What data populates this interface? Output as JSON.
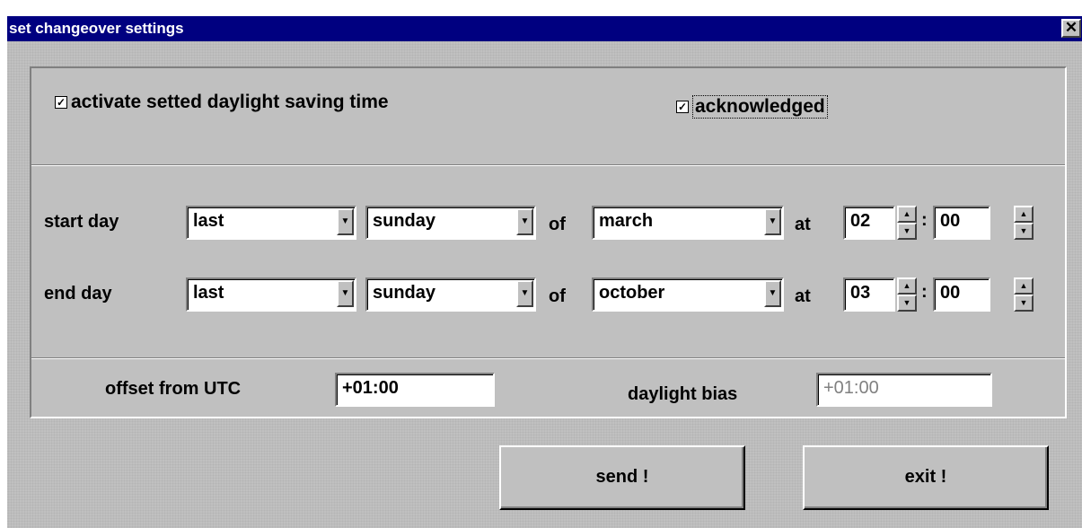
{
  "window": {
    "title": "set changeover settings",
    "close_symbol": "✕"
  },
  "top": {
    "activate_label": "activate setted daylight saving time",
    "activate_checked": true,
    "ack_label": "acknowledged",
    "ack_checked": true
  },
  "start": {
    "label": "start day",
    "week": "last",
    "weekday": "sunday",
    "of": "of",
    "month": "march",
    "at": "at",
    "hour": "02",
    "minute": "00"
  },
  "end": {
    "label": "end day",
    "week": "last",
    "weekday": "sunday",
    "of": "of",
    "month": "october",
    "at": "at",
    "hour": "03",
    "minute": "00"
  },
  "time_separator": ":",
  "offset": {
    "label": "offset from UTC",
    "value": "+01:00"
  },
  "bias": {
    "label": "daylight bias",
    "value": "+01:00"
  },
  "buttons": {
    "send": "send !",
    "exit": "exit !"
  },
  "glyphs": {
    "check": "✓",
    "dropdown": "▼",
    "up": "▲",
    "down": "▼"
  }
}
